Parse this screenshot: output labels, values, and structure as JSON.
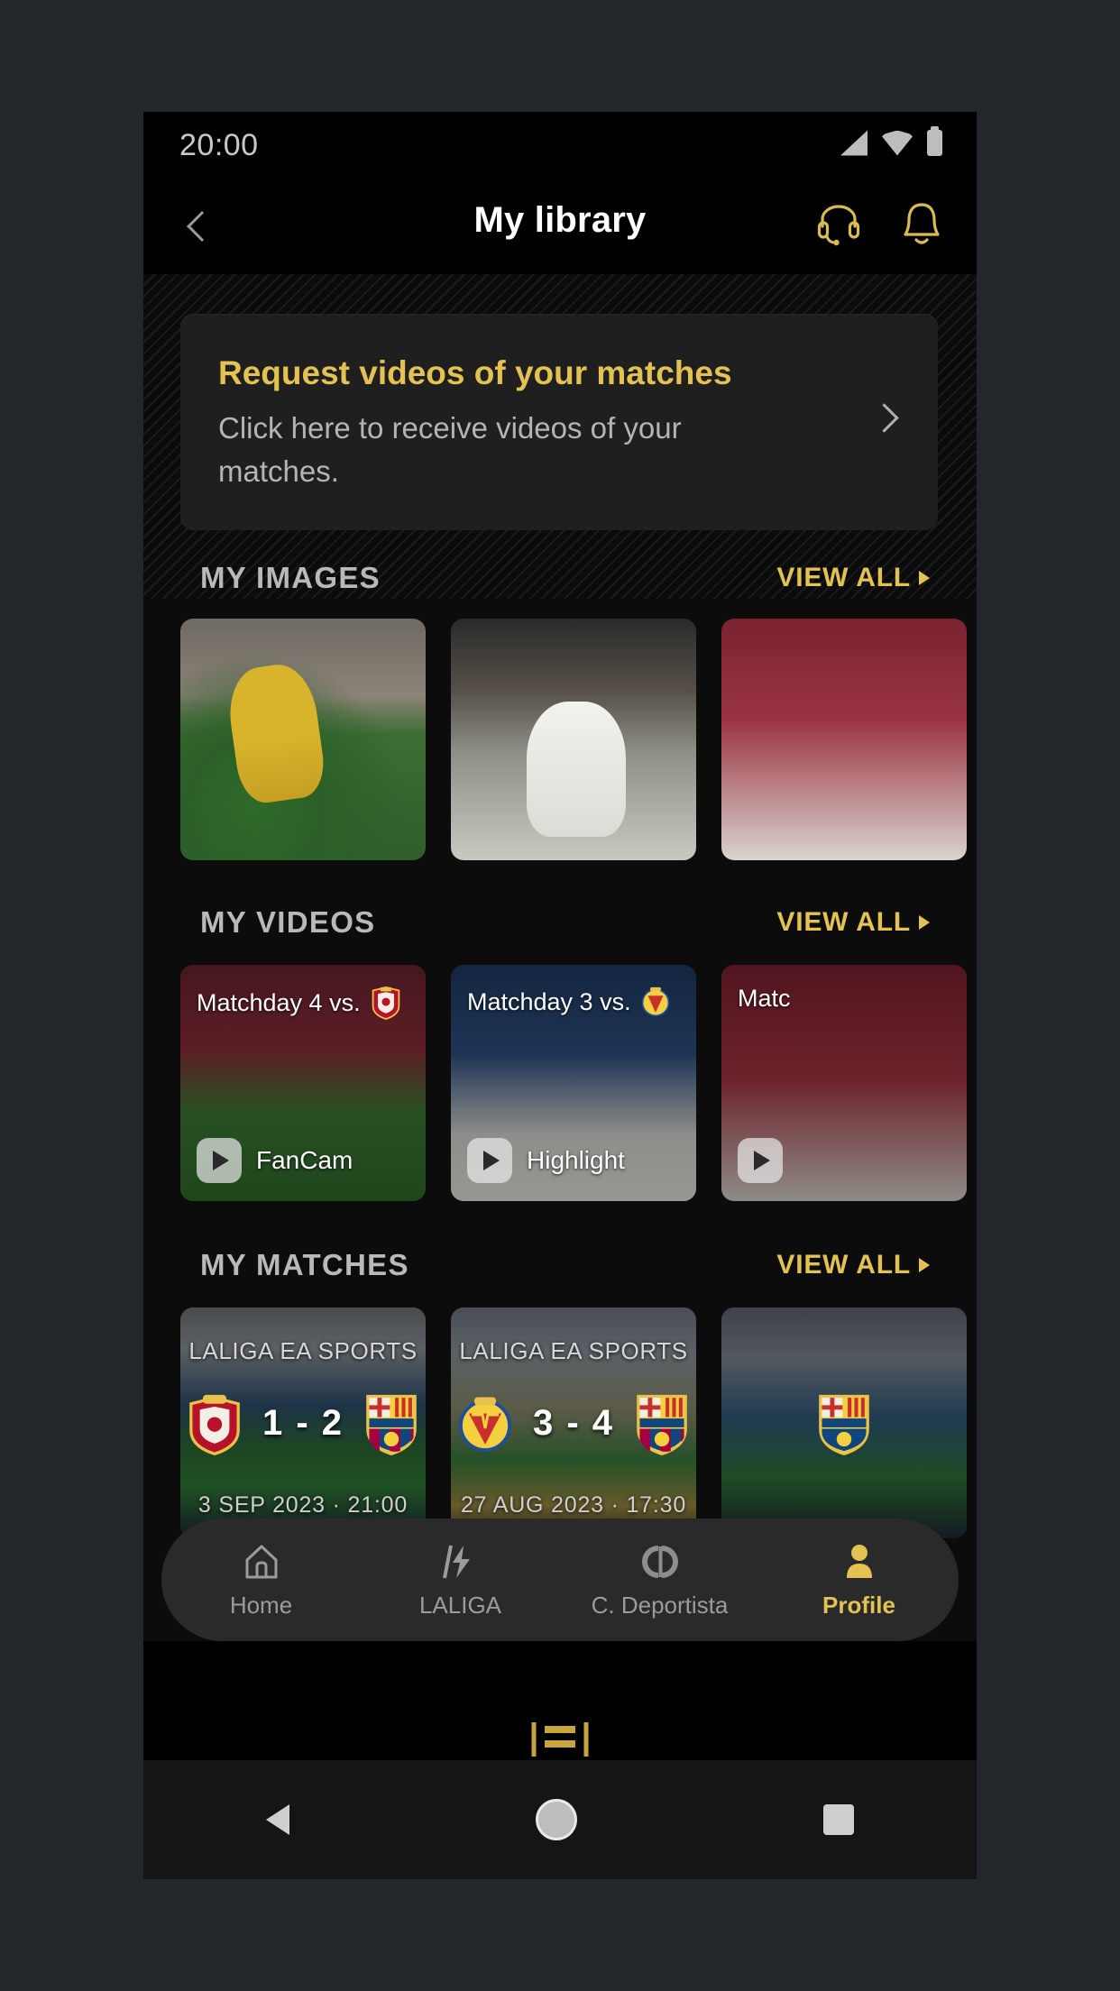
{
  "theme": {
    "accent": "#e3c252",
    "background": "#0c0c0c",
    "text_primary": "#ffffff",
    "text_muted": "#b4b4b4"
  },
  "status_bar": {
    "time": "20:00",
    "icons": [
      "signal-icon",
      "wifi-icon",
      "battery-icon"
    ]
  },
  "header": {
    "back_icon": "chevron-left-icon",
    "title": "My library",
    "actions": [
      {
        "icon": "headset-icon",
        "name": "support-button"
      },
      {
        "icon": "bell-icon",
        "name": "notifications-button"
      }
    ]
  },
  "promo": {
    "title": "Request videos of your matches",
    "subtitle": "Click here to receive videos of your matches.",
    "chevron": "chevron-right-icon"
  },
  "sections": {
    "images": {
      "title": "MY IMAGES",
      "view_all": "VIEW ALL",
      "items": [
        {
          "alt": "player-in-yellow-kit-running"
        },
        {
          "alt": "player-celebrating-finger-to-lips"
        },
        {
          "alt": "partially-visible-photo"
        }
      ]
    },
    "videos": {
      "title": "MY VIDEOS",
      "view_all": "VIEW ALL",
      "items": [
        {
          "top_label": "Matchday 4 vs.",
          "crest": "osasuna-crest",
          "type_label": "FanCam"
        },
        {
          "top_label": "Matchday 3 vs.",
          "crest": "villarreal-crest",
          "type_label": "Highlight"
        },
        {
          "top_label": "Matc",
          "crest": "",
          "type_label": ""
        }
      ]
    },
    "matches": {
      "title": "MY MATCHES",
      "view_all": "VIEW ALL",
      "items": [
        {
          "competition": "LALIGA EA SPORTS",
          "home_crest": "osasuna-crest",
          "away_crest": "barcelona-crest",
          "score": "1 - 2",
          "datetime": "3 SEP 2023 · 21:00"
        },
        {
          "competition": "LALIGA EA SPORTS",
          "home_crest": "villarreal-crest",
          "away_crest": "barcelona-crest",
          "score": "3 - 4",
          "datetime": "27 AUG 2023 · 17:30"
        },
        {
          "competition": "",
          "home_crest": "barcelona-crest",
          "away_crest": "",
          "score": "",
          "datetime": ""
        }
      ]
    }
  },
  "tabbar": {
    "items": [
      {
        "label": "Home",
        "icon": "home-icon",
        "active": false
      },
      {
        "label": "LALIGA",
        "icon": "laliga-logo-icon",
        "active": false
      },
      {
        "label": "C. Deportista",
        "icon": "cd-monogram-icon",
        "active": false
      },
      {
        "label": "Profile",
        "icon": "person-icon",
        "active": true
      }
    ]
  },
  "android_nav": {
    "back": "triangle-back-icon",
    "home": "circle-home-icon",
    "recents": "square-recents-icon"
  }
}
